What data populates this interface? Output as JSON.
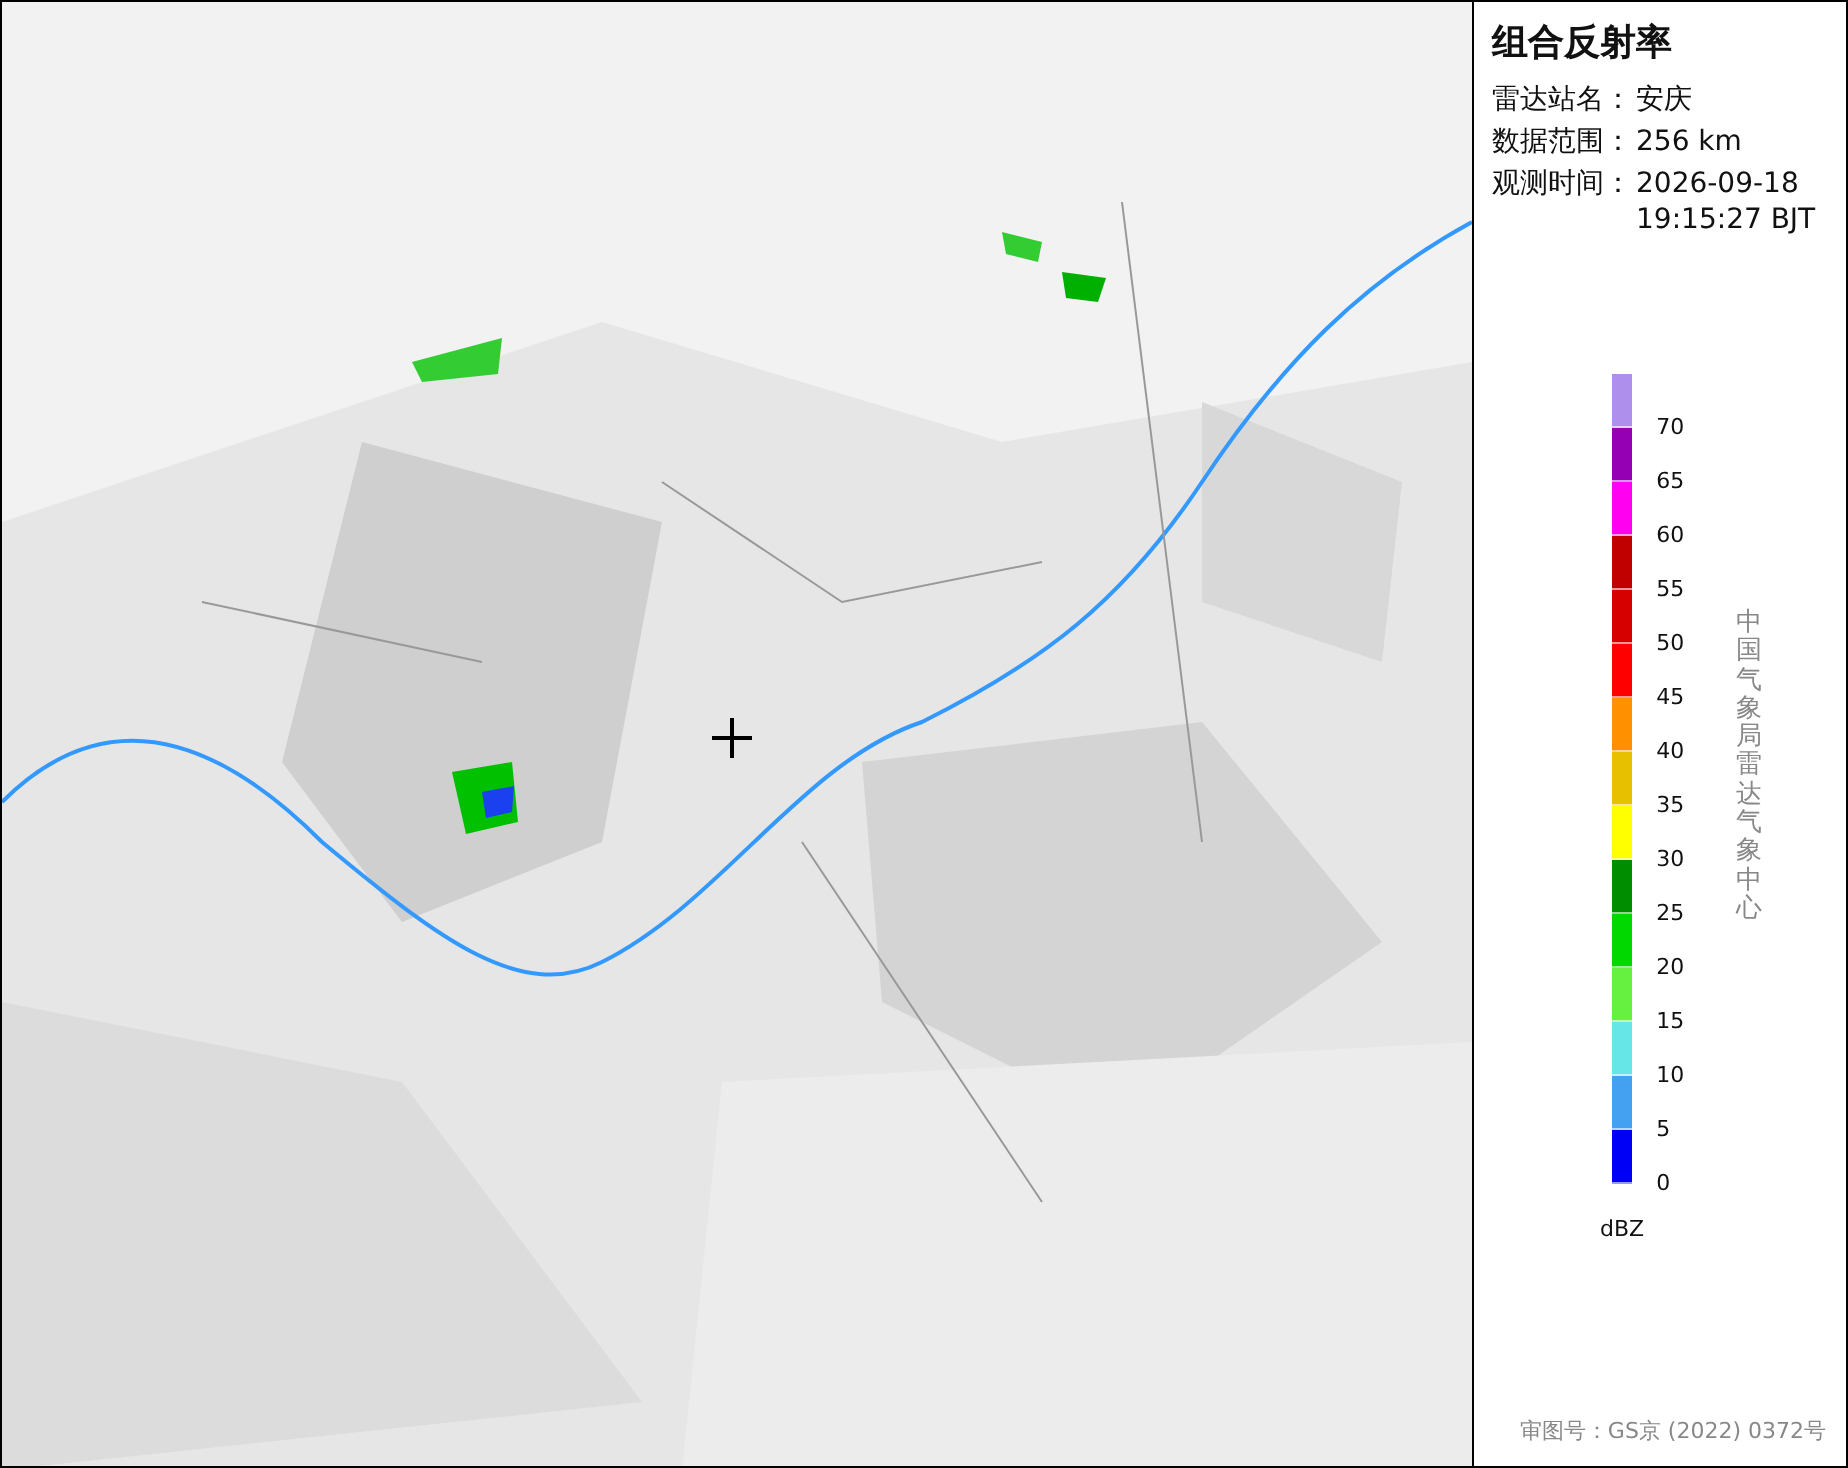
{
  "panel": {
    "title": "组合反射率",
    "info": [
      {
        "label": "雷达站名：",
        "value": "安庆"
      },
      {
        "label": "数据范围：",
        "value": "256 km"
      },
      {
        "label": "观测时间：",
        "value": "2026-09-18\n19:15:27 BJT"
      }
    ],
    "legend": [
      {
        "color": "#ae90ec",
        "label": "70"
      },
      {
        "color": "#9600b4",
        "label": "65"
      },
      {
        "color": "#ff00f0",
        "label": "60"
      },
      {
        "color": "#c00000",
        "label": "55"
      },
      {
        "color": "#d60000",
        "label": "50"
      },
      {
        "color": "#ff0000",
        "label": "45"
      },
      {
        "color": "#ff9000",
        "label": "40"
      },
      {
        "color": "#e7c000",
        "label": "35"
      },
      {
        "color": "#ffff00",
        "label": "30"
      },
      {
        "color": "#008e00",
        "label": "25"
      },
      {
        "color": "#00d800",
        "label": "20"
      },
      {
        "color": "#66f040",
        "label": "15"
      },
      {
        "color": "#66e6e6",
        "label": "10"
      },
      {
        "color": "#44a0f0",
        "label": "5"
      },
      {
        "color": "#0000f6",
        "label": "0"
      }
    ],
    "unit": "dBZ",
    "credit": "中国气象局雷达气象中心",
    "footer": "审图号：GS京 (2022) 0372号"
  }
}
